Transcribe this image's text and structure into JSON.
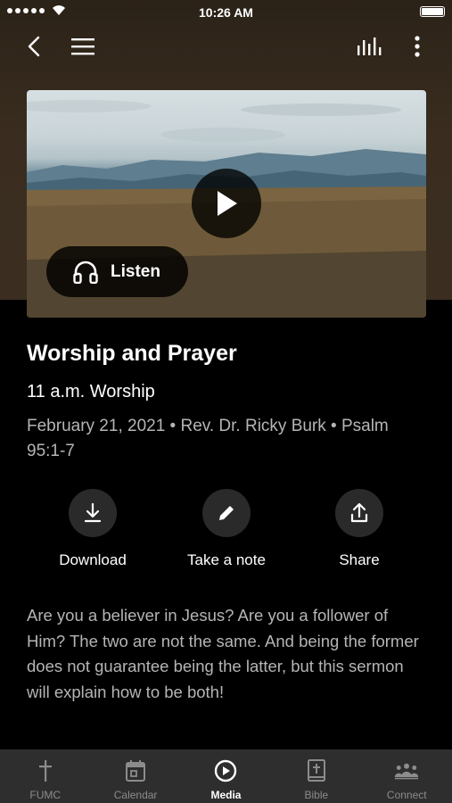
{
  "status_bar": {
    "time": "10:26 AM"
  },
  "nav": {
    "back_icon": "chevron-left-icon",
    "menu_icon": "hamburger-menu-icon",
    "audio_icon": "equalizer-icon",
    "more_icon": "more-vertical-icon"
  },
  "hero": {
    "play_icon": "play-icon",
    "listen_label": "Listen",
    "listen_icon": "headphones-icon"
  },
  "sermon": {
    "title": "Worship and Prayer",
    "service": "11 a.m. Worship",
    "meta": "February 21, 2021 • Rev. Dr. Ricky Burk • Psalm 95:1-7",
    "description": "Are you a believer in Jesus? Are you a follower of Him? The two are not the same. And being the former does not guarantee being the latter, but this sermon will explain how to be both!"
  },
  "actions": [
    {
      "label": "Download",
      "icon": "download-icon"
    },
    {
      "label": "Take a note",
      "icon": "pencil-icon"
    },
    {
      "label": "Share",
      "icon": "share-icon"
    }
  ],
  "tabs": [
    {
      "label": "FUMC",
      "icon": "cross-icon",
      "active": false
    },
    {
      "label": "Calendar",
      "icon": "calendar-icon",
      "active": false
    },
    {
      "label": "Media",
      "icon": "play-circle-icon",
      "active": true
    },
    {
      "label": "Bible",
      "icon": "bible-icon",
      "active": false
    },
    {
      "label": "Connect",
      "icon": "people-icon",
      "active": false
    }
  ],
  "colors": {
    "background": "#000000",
    "header_brown": "#3a2d1f",
    "secondary_text": "#b5b5b5",
    "tab_bar": "#2e2e2e",
    "action_circle": "#2a2a2a"
  }
}
